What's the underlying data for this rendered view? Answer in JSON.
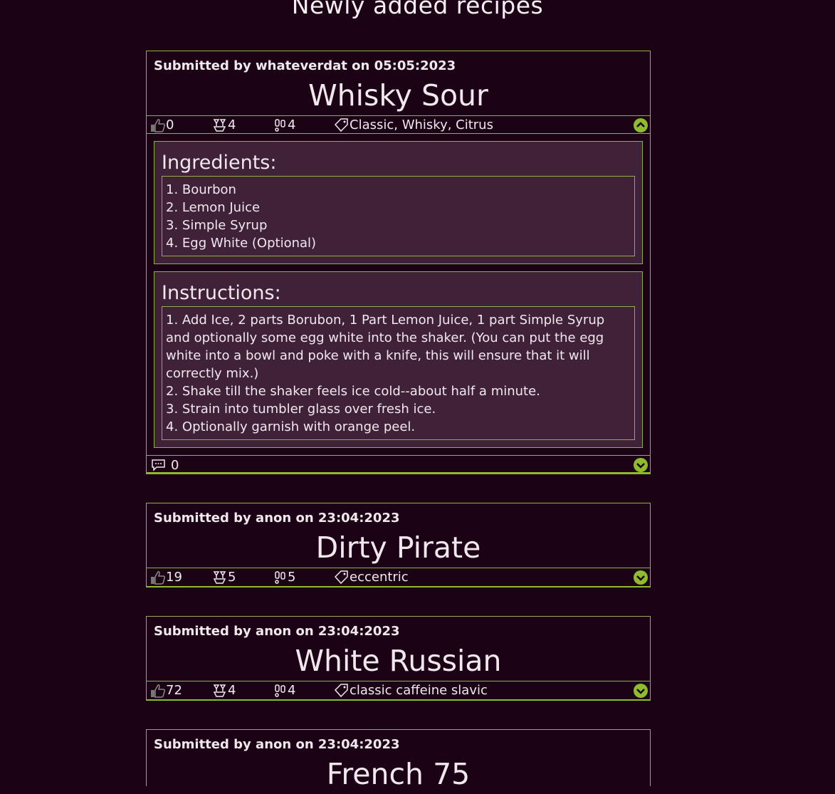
{
  "page": {
    "title": "Newly added recipes"
  },
  "colors": {
    "background": "#1b0315",
    "border": "#8fae4c",
    "accent": "#8fbc2c",
    "panel": "#402238"
  },
  "recipes": [
    {
      "submitted": "Submitted by whateverdat on 05:05:2023",
      "name": "Whisky Sour",
      "likes": "0",
      "glasses": "4",
      "servings": "4",
      "tags": "Classic, Whisky, Citrus",
      "expanded": true,
      "ingredients_title": "Ingredients:",
      "ingredients": [
        "1. Bourbon",
        "2. Lemon Juice",
        "3. Simple Syrup",
        "4. Egg White (Optional)"
      ],
      "instructions_title": "Instructions:",
      "instructions": [
        "1. Add Ice, 2 parts Borubon, 1 Part Lemon Juice, 1 part Simple Syrup and optionally some egg white into the shaker. (You can put the egg white into a bowl and poke with a knife, this will ensure that it will correctly mix.)",
        "2. Shake till the shaker feels ice cold--about half a minute.",
        "3. Strain into tumbler glass over fresh ice.",
        "4. Optionally garnish with orange peel."
      ],
      "comments": "0"
    },
    {
      "submitted": "Submitted by anon on 23:04:2023",
      "name": "Dirty Pirate",
      "likes": "19",
      "glasses": "5",
      "servings": "5",
      "tags": "eccentric",
      "expanded": false
    },
    {
      "submitted": "Submitted by anon on 23:04:2023",
      "name": "White Russian",
      "likes": "72",
      "glasses": "4",
      "servings": "4",
      "tags": "classic caffeine slavic",
      "expanded": false
    },
    {
      "submitted": "Submitted by anon on 23:04:2023",
      "name": "French 75",
      "expanded": false
    }
  ],
  "icons": {
    "likes": "thumbs-up-icon",
    "glasses": "glasses-icon",
    "servings": "servings-icon",
    "tags": "tag-icon",
    "comments": "comment-icon",
    "collapse": "chevron-up-icon",
    "expand": "chevron-down-icon"
  }
}
